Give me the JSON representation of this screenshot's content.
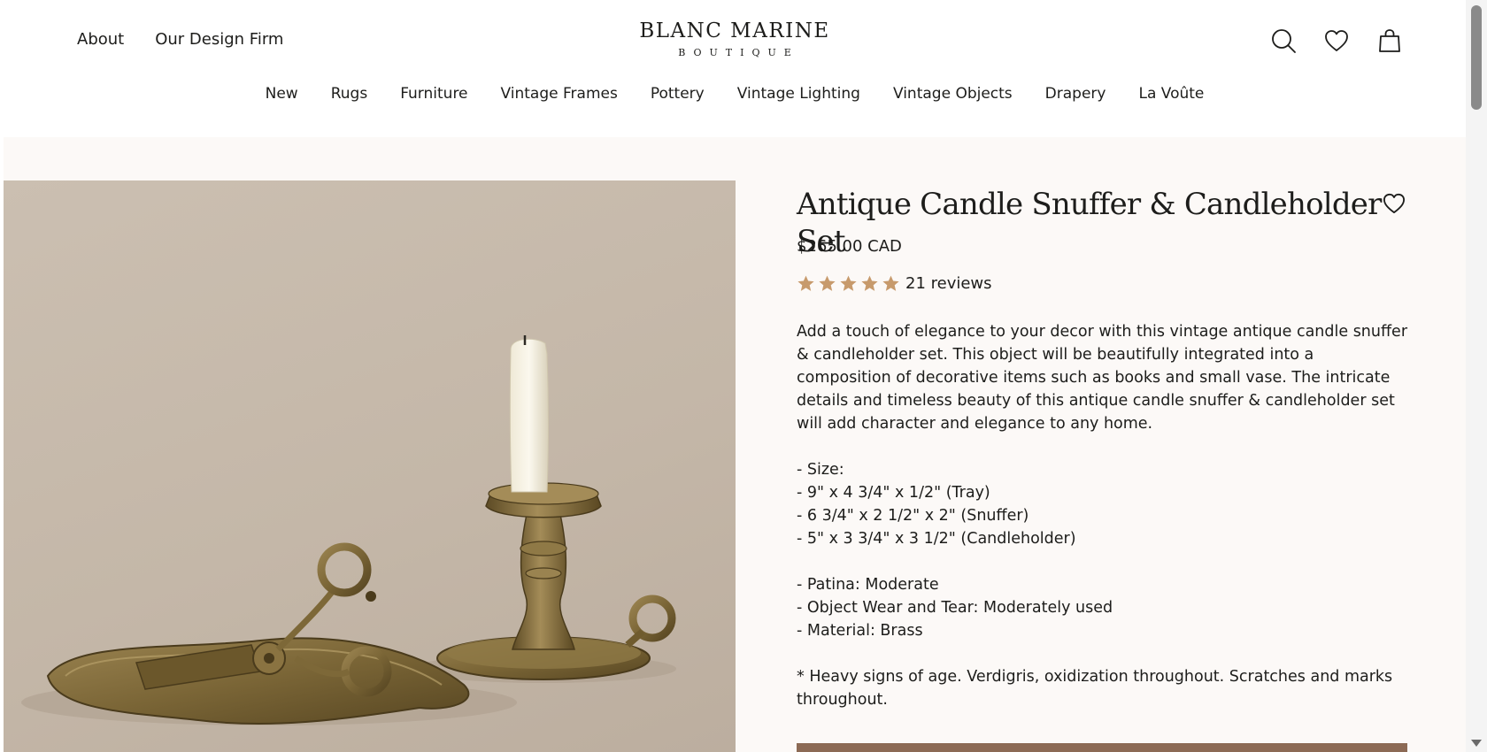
{
  "header": {
    "top_links": [
      "About",
      "Our Design Firm"
    ],
    "logo_main": "BLANC MARINE",
    "logo_sub": "BOUTIQUE",
    "icons": [
      "search-icon",
      "heart-icon",
      "bag-icon"
    ]
  },
  "nav": {
    "items": [
      "New",
      "Rugs",
      "Furniture",
      "Vintage Frames",
      "Pottery",
      "Vintage Lighting",
      "Vintage Objects",
      "Drapery",
      "La Voûte"
    ]
  },
  "product": {
    "title": "Antique Candle Snuffer & Candleholder Set",
    "price": "$265.00 CAD",
    "rating": 5,
    "reviews": "21 reviews",
    "description": "Add a touch of elegance to your decor with this vintage antique candle snuffer & candleholder set. This object will be beautifully integrated into a composition of decorative items such as books and small vase. The intricate details and timeless beauty of this antique candle snuffer & candleholder set will add character and elegance to any home.",
    "size_lines": [
      "- Size:",
      "- 9\" x 4 3/4\" x 1/2\" (Tray)",
      "- 6 3/4\" x 2 1/2\" x 2\" (Snuffer)",
      "- 5\" x 3 3/4\" x 3 1/2\" (Candleholder)"
    ],
    "detail_lines": [
      "- Patina: Moderate",
      "- Object Wear and Tear: Moderately used",
      "- Material: Brass"
    ],
    "note": "* Heavy signs of age. Verdigris, oxidization throughout. Scratches and marks throughout."
  },
  "colors": {
    "star": "#c79a6c",
    "accent": "#8c6a55",
    "background": "#fcf9f7"
  }
}
